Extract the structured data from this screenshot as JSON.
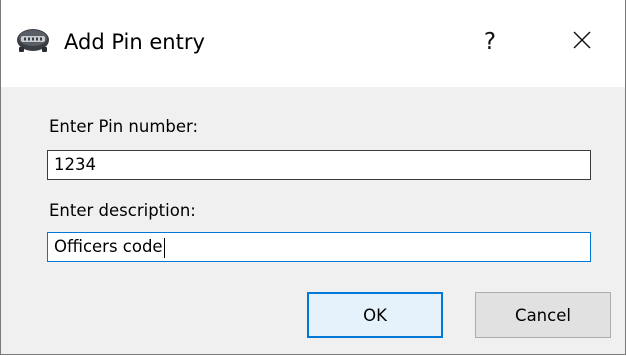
{
  "window": {
    "title": "Add Pin entry",
    "help_glyph": "?",
    "close_icon": "close-icon",
    "app_icon": "vault-icon"
  },
  "form": {
    "pin_label": "Enter Pin number:",
    "pin_value": "1234",
    "description_label": "Enter description:",
    "description_value": "Officers code",
    "focused_field": "description"
  },
  "buttons": {
    "ok_label": "OK",
    "cancel_label": "Cancel"
  },
  "colors": {
    "accent": "#0078d7",
    "titlebar": "#ffffff",
    "body": "#f0f0f0"
  }
}
